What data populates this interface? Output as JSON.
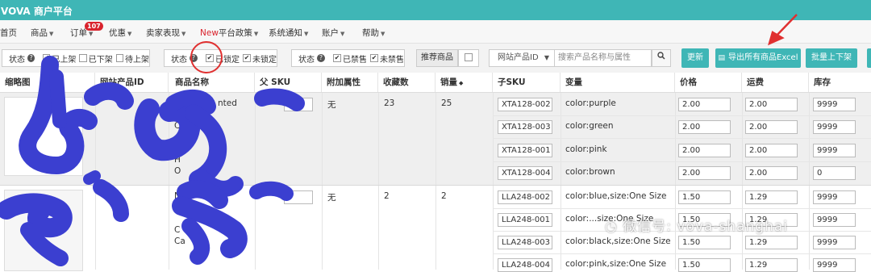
{
  "app": {
    "brand": "VOVA 商户平台"
  },
  "nav": {
    "items": [
      {
        "label": "首页",
        "caret": false
      },
      {
        "label": "商品",
        "caret": true
      },
      {
        "label": "订单",
        "caret": true,
        "badge": "107"
      },
      {
        "label": "优惠",
        "caret": true
      },
      {
        "label": "卖家表现",
        "caret": true
      },
      {
        "label": "平台政策",
        "caret": true,
        "prefix": "New"
      },
      {
        "label": "系统通知",
        "caret": true
      },
      {
        "label": "账户",
        "caret": true
      },
      {
        "label": "帮助",
        "caret": true
      }
    ]
  },
  "filters": {
    "group1": {
      "label": "状态",
      "options": [
        {
          "label": "已上架",
          "checked": true
        },
        {
          "label": "已下架",
          "checked": false
        },
        {
          "label": "待上架",
          "checked": false
        }
      ]
    },
    "group2": {
      "label": "状态",
      "options": [
        {
          "label": "已锁定",
          "checked": true
        },
        {
          "label": "未锁定",
          "checked": true
        }
      ]
    },
    "group3": {
      "label": "状态",
      "options": [
        {
          "label": "已禁售",
          "checked": true
        },
        {
          "label": "未禁售",
          "checked": true
        }
      ]
    },
    "recommend_label": "推荐商品",
    "select_value": "网站产品ID",
    "search_placeholder": "搜索产品名称与属性",
    "refresh_label": "更新",
    "export_label": "导出所有商品Excel",
    "batch_label": "批量上下架"
  },
  "table": {
    "headers": [
      "缩略图",
      "网站产品ID",
      "商品名称",
      "父 SKU",
      "附加属性",
      "收藏数",
      "销量",
      "子SKU",
      "变量",
      "价格",
      "运费",
      "库存"
    ],
    "sort_header": "销量",
    "groups": [
      {
        "name_fragments": [
          "nted",
          "C",
          "H",
          "O"
        ],
        "extra_attr": "无",
        "favorites": "23",
        "sales": "25",
        "variants": [
          {
            "sku": "XTA128-002",
            "variant": "color:purple",
            "price": "2.00",
            "shipping": "2.00",
            "stock": "9999"
          },
          {
            "sku": "XTA128-003",
            "variant": "color:green",
            "price": "2.00",
            "shipping": "2.00",
            "stock": "9999"
          },
          {
            "sku": "XTA128-001",
            "variant": "color:pink",
            "price": "2.00",
            "shipping": "2.00",
            "stock": "9999"
          },
          {
            "sku": "XTA128-004",
            "variant": "color:brown",
            "price": "2.00",
            "shipping": "2.00",
            "stock": "0"
          }
        ]
      },
      {
        "name_fragments": [
          "N",
          "C",
          "Ca"
        ],
        "extra_attr": "无",
        "favorites": "2",
        "sales": "2",
        "variants": [
          {
            "sku": "LLA248-002",
            "variant": "color:blue,size:One Size",
            "price": "1.50",
            "shipping": "1.29",
            "stock": "9999"
          },
          {
            "sku": "LLA248-001",
            "variant": "color:...size:One Size",
            "price": "1.50",
            "shipping": "1.29",
            "stock": "9999"
          },
          {
            "sku": "LLA248-003",
            "variant": "color:black,size:One Size",
            "price": "1.50",
            "shipping": "1.29",
            "stock": "9999"
          },
          {
            "sku": "LLA248-004",
            "variant": "color:pink,size:One Size",
            "price": "1.50",
            "shipping": "1.29",
            "stock": "9999"
          }
        ]
      }
    ]
  },
  "watermark": "微信号: vova-shanghai",
  "colors": {
    "accent": "#3fb6b6",
    "badge": "#d9232d",
    "redaction": "#3b3fd0",
    "annotation": "#e03030"
  }
}
